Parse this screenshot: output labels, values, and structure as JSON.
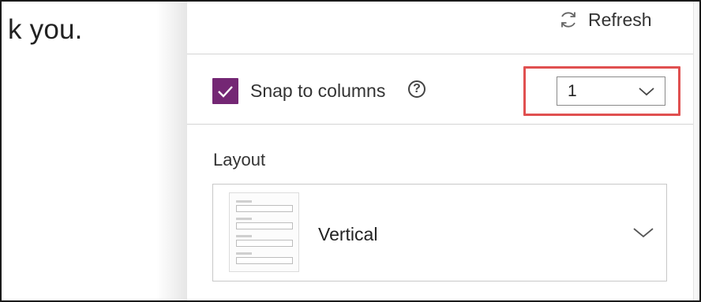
{
  "canvas": {
    "partial_text": "k you."
  },
  "panel": {
    "refresh_label": "Refresh",
    "snap": {
      "checked": true,
      "label": "Snap to columns",
      "help_icon": "question-circle-icon"
    },
    "columns": {
      "value": "1",
      "icon": "chevron-down-icon",
      "highlight_color": "#e05050"
    },
    "layout": {
      "title": "Layout",
      "value": "Vertical",
      "icon": "chevron-down-icon"
    }
  },
  "colors": {
    "accent": "#742774",
    "highlight": "#e05050",
    "text": "#333333"
  }
}
